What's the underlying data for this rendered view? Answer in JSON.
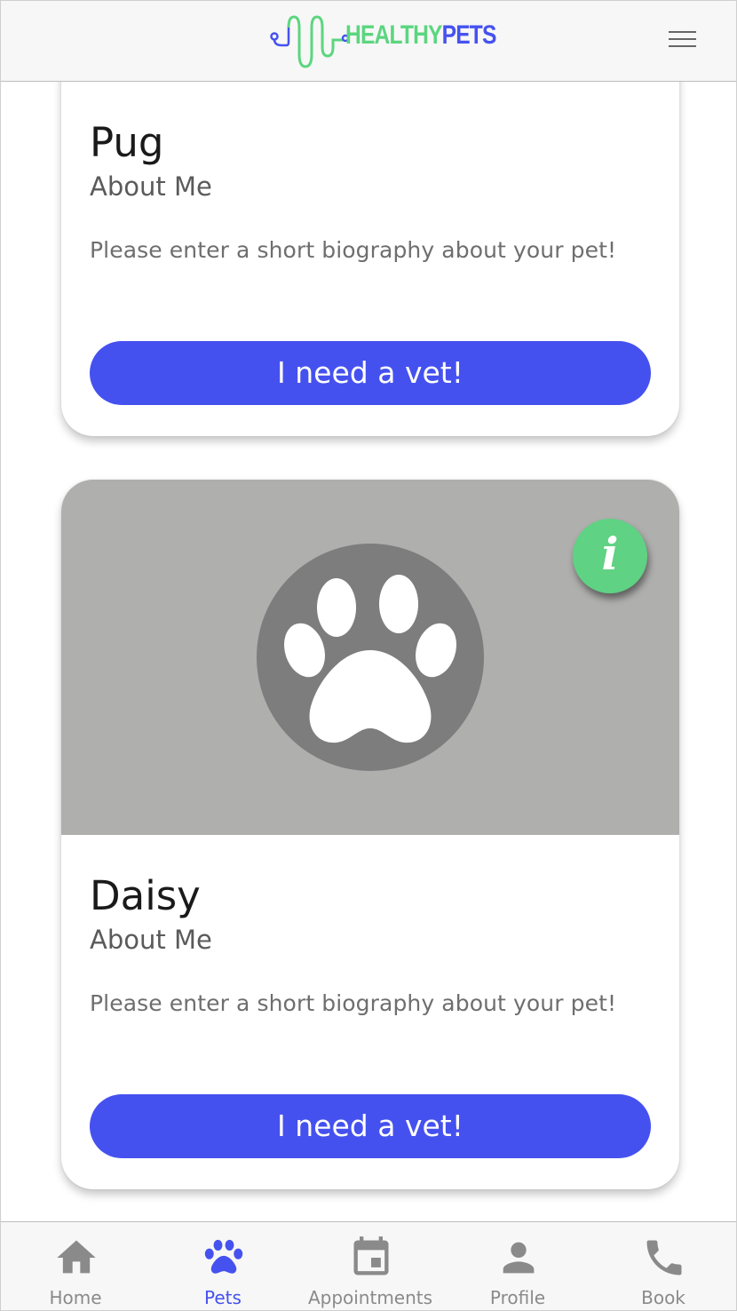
{
  "header": {
    "logo_word1": "HEALTHY",
    "logo_word2": "PETS"
  },
  "pets": [
    {
      "name": "Pug",
      "about_label": "About Me",
      "bio": "Please enter a short biography about your pet!",
      "button_label": "I need a vet!"
    },
    {
      "name": "Daisy",
      "about_label": "About Me",
      "bio": "Please enter a short biography about your pet!",
      "button_label": "I need a vet!",
      "info_icon": "i"
    }
  ],
  "bottom_nav": [
    {
      "label": "Home",
      "icon": "home-icon",
      "active": false
    },
    {
      "label": "Pets",
      "icon": "paw-icon",
      "active": true
    },
    {
      "label": "Appointments",
      "icon": "calendar-icon",
      "active": false
    },
    {
      "label": "Profile",
      "icon": "person-icon",
      "active": false
    },
    {
      "label": "Book",
      "icon": "phone-icon",
      "active": false
    }
  ],
  "colors": {
    "accent": "#4552ef",
    "brand_green": "#5bd67f",
    "image_bg": "#afafae",
    "paw_circle": "#7d7d7e",
    "nav_inactive": "#8a8a8a"
  }
}
